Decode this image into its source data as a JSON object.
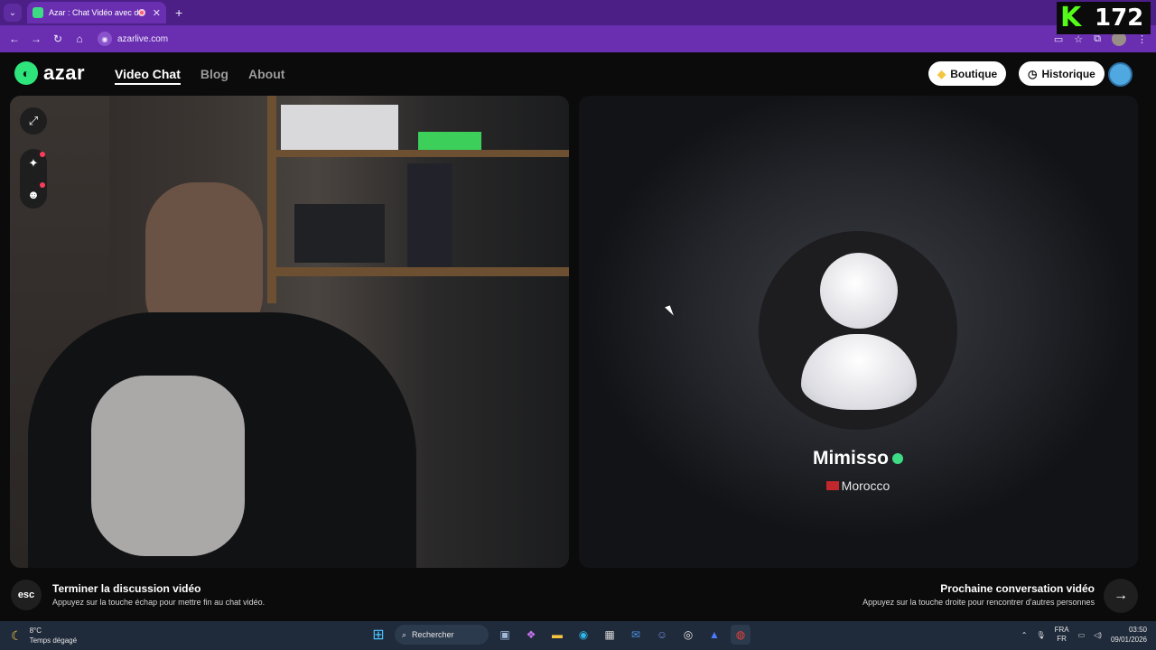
{
  "browser": {
    "tab_title": "Azar : Chat Vidéo avec de n",
    "url": "azarlive.com"
  },
  "overlay": {
    "viewer_count": "172",
    "logo_letter": "K"
  },
  "site": {
    "logo_text": "azar",
    "nav": {
      "video_chat": "Video Chat",
      "blog": "Blog",
      "about": "About"
    },
    "boutique_label": "Boutique",
    "historique_label": "Historique"
  },
  "peer": {
    "name": "Mimisso",
    "country": "Morocco"
  },
  "bottom": {
    "esc_key": "esc",
    "end_title": "Terminer la discussion vidéo",
    "end_sub": "Appuyez sur la touche échap pour mettre fin au chat vidéo.",
    "next_title": "Prochaine conversation vidéo",
    "next_sub": "Appuyez sur la touche droite pour rencontrer d'autres personnes"
  },
  "taskbar": {
    "weather_temp": "8°C",
    "weather_desc": "Temps dégagé",
    "search_placeholder": "Rechercher",
    "lang_top": "FRA",
    "lang_bottom": "FR",
    "time": "03:50",
    "date": "09/01/2026"
  },
  "colors": {
    "tabbar": "#4b1f86",
    "addressbar": "#6a2fb0",
    "azar_green": "#2ee57b",
    "kick_green": "#53fc18"
  }
}
